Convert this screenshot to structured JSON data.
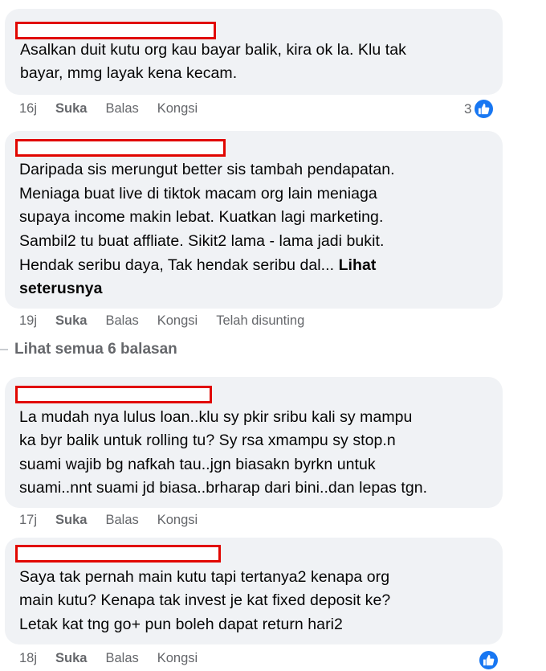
{
  "comments": [
    {
      "lines": [
        "Asalkan duit kutu org kau bayar balik, kira ok la. Klu tak",
        "bayar, mmg layak kena kecam."
      ],
      "actions": {
        "time": "16j",
        "like": "Suka",
        "reply": "Balas",
        "share": "Kongsi"
      },
      "reaction_count": "3"
    },
    {
      "lines": [
        "Daripada sis merungut better sis tambah pendapatan.",
        "Meniaga buat live di tiktok macam org lain meniaga",
        "supaya income makin lebat. Kuatkan lagi marketing.",
        "Sambil2 tu buat affliate. Sikit2 lama - lama jadi bukit.",
        "Hendak seribu daya, Tak hendak seribu dal... "
      ],
      "see_more_a": "Lihat",
      "see_more_b": "seterusnya",
      "actions": {
        "time": "19j",
        "like": "Suka",
        "reply": "Balas",
        "share": "Kongsi",
        "edited": "Telah disunting"
      }
    },
    {
      "lines": [
        "La mudah nya lulus loan..klu sy pkir sribu kali sy mampu",
        "ka byr balik untuk rolling tu? Sy rsa xmampu sy stop.n",
        "suami wajib bg nafkah tau..jgn biasakn byrkn untuk",
        "suami..nnt suami jd biasa..brharap dari bini..dan lepas tgn."
      ],
      "actions": {
        "time": "17j",
        "like": "Suka",
        "reply": "Balas",
        "share": "Kongsi"
      }
    },
    {
      "lines": [
        "Saya tak pernah main kutu tapi tertanya2 kenapa org",
        "main kutu? Kenapa tak invest je kat fixed deposit ke?",
        "Letak kat tng go+ pun boleh dapat return hari2"
      ],
      "actions": {
        "time": "18j",
        "like": "Suka",
        "reply": "Balas",
        "share": "Kongsi"
      }
    }
  ],
  "view_replies": "Lihat semua 6 balasan",
  "colors": {
    "bubble": "#f0f2f5",
    "redaction": "#e10600",
    "like_blue": "#1877f2",
    "meta": "#65676b"
  }
}
